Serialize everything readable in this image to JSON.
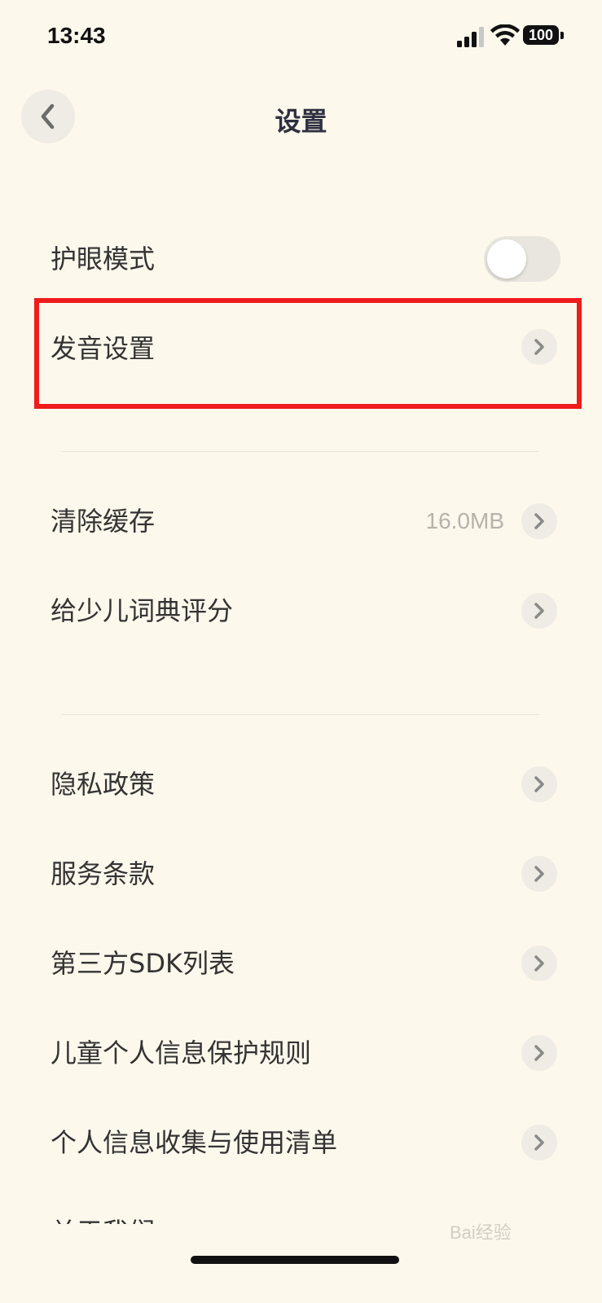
{
  "status_bar": {
    "time": "13:43",
    "battery": "100"
  },
  "header": {
    "title": "设置",
    "back_icon": "chevron-left-icon"
  },
  "section1": {
    "eye_mode_label": "护眼模式",
    "eye_mode_toggle_on": false,
    "pronunciation_label": "发音设置"
  },
  "section2": {
    "clear_cache_label": "清除缓存",
    "cache_size": "16.0MB",
    "rate_label": "给少儿词典评分"
  },
  "section3": {
    "items": [
      {
        "label": "隐私政策"
      },
      {
        "label": "服务条款"
      },
      {
        "label": "第三方SDK列表"
      },
      {
        "label": "儿童个人信息保护规则"
      },
      {
        "label": "个人信息收集与使用清单"
      },
      {
        "label": "关于我们"
      }
    ]
  },
  "watermark": {
    "text": "Bai经验"
  },
  "colors": {
    "background": "#fdf8ec",
    "highlight": "#ee1c1c",
    "chevron_bg": "#efece5"
  }
}
